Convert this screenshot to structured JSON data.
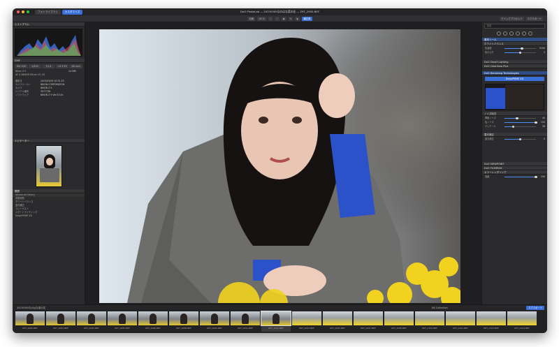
{
  "window": {
    "title": "DxO PhotoLab — 20230305なのはな菜の花 — Z9T_2092.NEF",
    "tabs": [
      "フォトライブラリ",
      "カスタマイズ"
    ],
    "active_tab": 1
  },
  "toolbar": {
    "compare": "比較",
    "zoom": "18 %",
    "preview": "補正前",
    "quick_presets": "クイックプリセット",
    "export": "エクスポート"
  },
  "left": {
    "histogram_title": "ヒストグラム",
    "exif_section": "EXIF",
    "camera": "Nikon Z 9",
    "focal": "24 MM",
    "lens": "AF-S NIKKOR 85mm f/1.4G",
    "exif_values": [
      "ISO 100",
      "1/320",
      "f/1.4",
      "+0.3 EV",
      "85 mm"
    ],
    "meta_rows": [
      {
        "k": "撮影日",
        "v": "2023/03/05 10:31:23"
      },
      {
        "k": "カメラメーカー",
        "v": "NIKON CORPORATION"
      },
      {
        "k": "カメラ",
        "v": "NIKON Z 9"
      },
      {
        "k": "シリアル番号",
        "v": "3077736"
      },
      {
        "k": "ソフトウェア",
        "v": "NIKON Z 9 Ver.03.00"
      }
    ],
    "preview_section": "ナビゲーター",
    "history_section": "履歴",
    "history_tab": "Advanced history",
    "history_rows": [
      "初期状態",
      "ホワイトバランス",
      "露光補正",
      "コントラスト",
      "スマートライティング",
      "DeepPRIME XD"
    ]
  },
  "right": {
    "search_placeholder": "検索",
    "sections": [
      {
        "label": "基本ツール",
        "blue": true
      },
      {
        "label": "ホワイトバランス",
        "blue": false
      },
      {
        "label": "DxO Smart Lighting",
        "blue": false
      },
      {
        "label": "DxO ClearView Plus",
        "blue": false
      },
      {
        "label": "DxO Denoising Technologies",
        "blue": true
      },
      {
        "label": "ノイズ除去",
        "blue": false
      },
      {
        "label": "露光補正",
        "blue": false
      },
      {
        "label": "DxO VIEWPOINT",
        "blue": false
      },
      {
        "label": "DxO FILMPACK",
        "blue": false
      },
      {
        "label": "カラーレンダリング",
        "blue": false
      }
    ],
    "sliders": [
      {
        "label": "色温度",
        "value": 5100,
        "level": 0.55
      },
      {
        "label": "色かぶり",
        "value": 3,
        "level": 0.5
      },
      {
        "label": "輝度ノイズ",
        "value": 40,
        "level": 0.4
      },
      {
        "label": "色ノイズ",
        "value": 100,
        "level": 1.0
      },
      {
        "label": "ディテール",
        "value": 28,
        "level": 0.28
      },
      {
        "label": "露光補正",
        "value": 0,
        "level": 0.5
      },
      {
        "label": "強度",
        "value": 100,
        "level": 1.0
      }
    ],
    "deep_prime": "DeepPRIME XD"
  },
  "film": {
    "folder": "20230305なのはな菜の花",
    "filter": "NX Collection",
    "export_btn": "エクスポート",
    "thumbs": [
      "Z9T_2080.NEF",
      "Z9T_2081.NEF",
      "Z9T_2083.NEF",
      "Z9T_2085.NEF",
      "Z9T_2086.NEF",
      "Z9T_2088.NEF",
      "Z9T_2090.NEF",
      "Z9T_2091.NEF",
      "Z9T_2092.NEF",
      "Z9T_2093.NEF",
      "Z9T_2095.NEF",
      "Z9T_2097.NEF",
      "Z9T_2098.NEF",
      "Z9T_2100.NEF",
      "Z9T_2101.NEF",
      "Z9T_2103.NEF",
      "Z9T_2104.NEF"
    ],
    "selected": 8
  }
}
